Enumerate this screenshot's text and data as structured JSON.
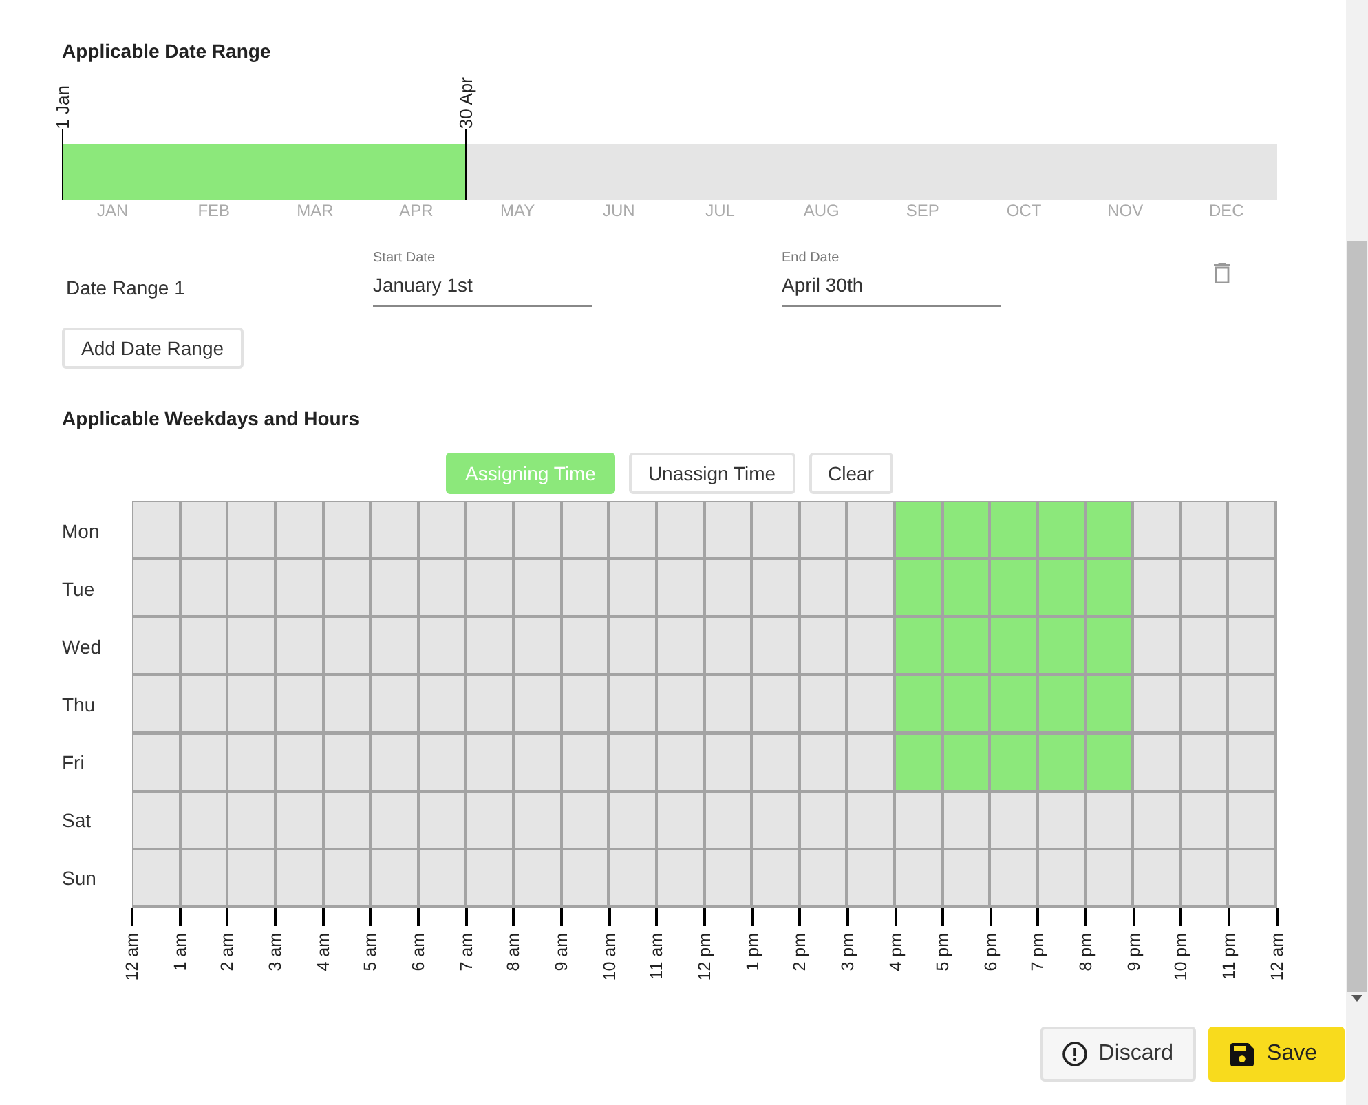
{
  "date_section": {
    "title": "Applicable Date Range",
    "bar": {
      "level": 0.3333,
      "start_label": "1 Jan",
      "end_label": "30 Apr"
    },
    "months": [
      "JAN",
      "FEB",
      "MAR",
      "APR",
      "MAY",
      "JUN",
      "JUL",
      "AUG",
      "SEP",
      "OCT",
      "NOV",
      "DEC"
    ],
    "ranges": [
      {
        "name": "Date Range 1",
        "start": {
          "label": "Start Date",
          "value": "January 1st"
        },
        "end": {
          "label": "End Date",
          "value": "April 30th"
        }
      }
    ],
    "add_button": "Add Date Range"
  },
  "schedule": {
    "title": "Applicable Weekdays and Hours",
    "mode_buttons": [
      {
        "label": "Assigning Time",
        "selected": true
      },
      {
        "label": "Unassign Time",
        "selected": false
      },
      {
        "label": "Clear",
        "selected": false
      }
    ],
    "rows": [
      {
        "day": "Mon",
        "cells": [
          false,
          false,
          false,
          false,
          false,
          false,
          false,
          false,
          false,
          false,
          false,
          false,
          false,
          false,
          false,
          false,
          true,
          true,
          true,
          true,
          true,
          false,
          false,
          false
        ]
      },
      {
        "day": "Tue",
        "cells": [
          false,
          false,
          false,
          false,
          false,
          false,
          false,
          false,
          false,
          false,
          false,
          false,
          false,
          false,
          false,
          false,
          true,
          true,
          true,
          true,
          true,
          false,
          false,
          false
        ]
      },
      {
        "day": "Wed",
        "cells": [
          false,
          false,
          false,
          false,
          false,
          false,
          false,
          false,
          false,
          false,
          false,
          false,
          false,
          false,
          false,
          false,
          true,
          true,
          true,
          true,
          true,
          false,
          false,
          false
        ]
      },
      {
        "day": "Thu",
        "cells": [
          false,
          false,
          false,
          false,
          false,
          false,
          false,
          false,
          false,
          false,
          false,
          false,
          false,
          false,
          false,
          false,
          true,
          true,
          true,
          true,
          true,
          false,
          false,
          false
        ]
      },
      {
        "day": "Fri",
        "cells": [
          false,
          false,
          false,
          false,
          false,
          false,
          false,
          false,
          false,
          false,
          false,
          false,
          false,
          false,
          false,
          false,
          true,
          true,
          true,
          true,
          true,
          false,
          false,
          false
        ]
      },
      {
        "day": "Sat",
        "cells": [
          false,
          false,
          false,
          false,
          false,
          false,
          false,
          false,
          false,
          false,
          false,
          false,
          false,
          false,
          false,
          false,
          false,
          false,
          false,
          false,
          false,
          false,
          false,
          false
        ]
      },
      {
        "day": "Sun",
        "cells": [
          false,
          false,
          false,
          false,
          false,
          false,
          false,
          false,
          false,
          false,
          false,
          false,
          false,
          false,
          false,
          false,
          false,
          false,
          false,
          false,
          false,
          false,
          false,
          false
        ]
      }
    ],
    "hour_labels": [
      "12 am",
      "1 am",
      "2 am",
      "3 am",
      "4 am",
      "5 am",
      "6 am",
      "7 am",
      "8 am",
      "9 am",
      "10 am",
      "11 am",
      "12 pm",
      "1 pm",
      "2 pm",
      "3 pm",
      "4 pm",
      "5 pm",
      "6 pm",
      "7 pm",
      "8 pm",
      "9 pm",
      "10 pm",
      "11 pm",
      "12 am"
    ]
  },
  "footer": {
    "discard": "Discard",
    "save": "Save"
  }
}
